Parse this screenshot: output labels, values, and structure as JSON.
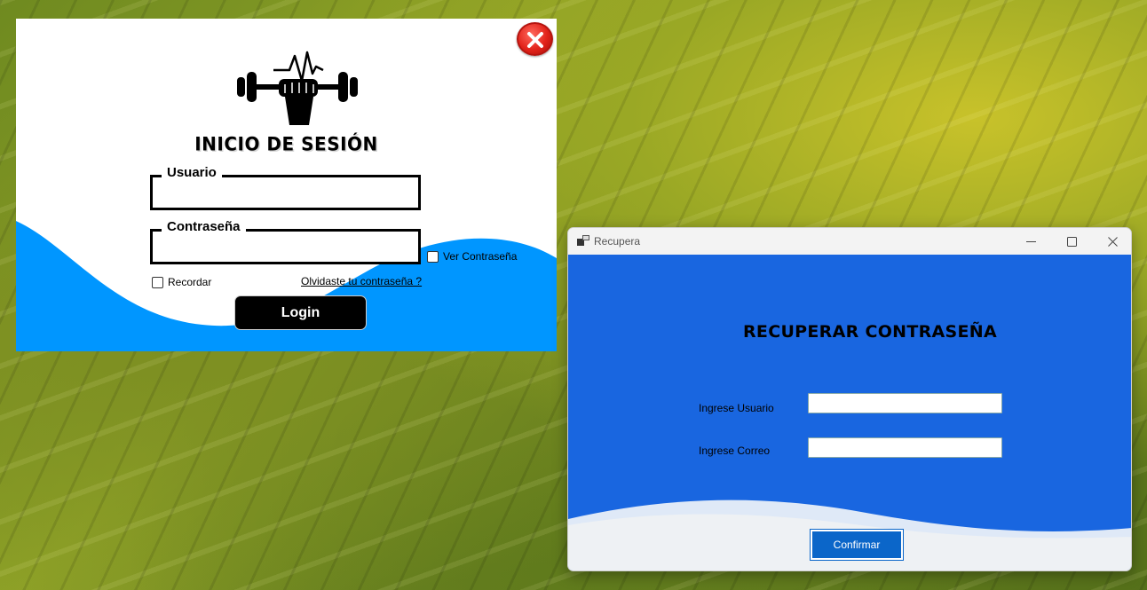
{
  "login": {
    "title": "INICIO DE SESIÓN",
    "username_label": "Usuario",
    "username_value": "",
    "password_label": "Contraseña",
    "password_value": "",
    "show_password_label": "Ver Contraseña",
    "remember_label": "Recordar",
    "forgot_link": "Olvidaste tu contraseña ?",
    "login_button": "Login",
    "logo_icon": "fist-dumbbell-heartbeat-icon",
    "close_icon": "close-icon",
    "accent_color": "#0096ff"
  },
  "recupera": {
    "window_title": "Recupera",
    "heading": "RECUPERAR CONTRASEÑA",
    "user_label": "Ingrese Usuario",
    "user_value": "",
    "email_label": "Ingrese Correo",
    "email_value": "",
    "confirm_button": "Confirmar",
    "background_color": "#1966e0",
    "button_color": "#0b66c9"
  }
}
